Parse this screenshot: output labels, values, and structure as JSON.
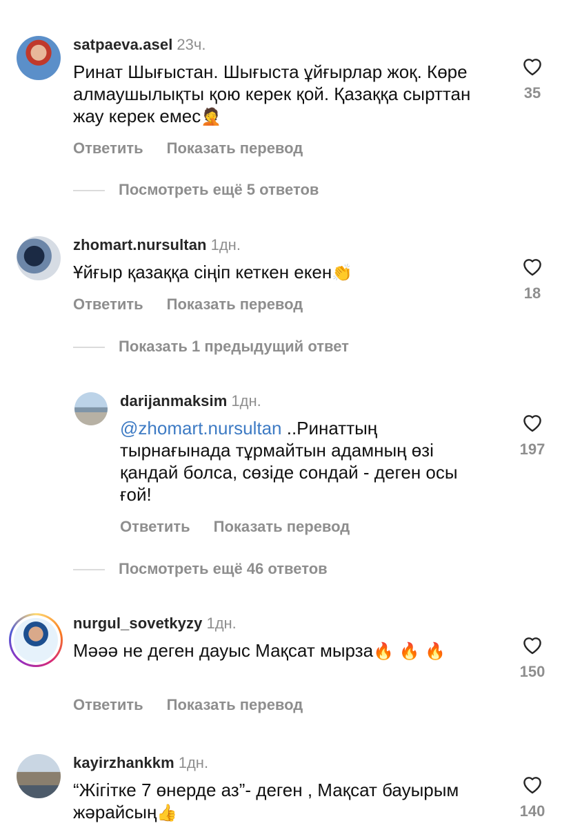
{
  "colors": {
    "accent": "#3e7bc4",
    "muted": "#8e8e8e",
    "story_ring": "#d62976"
  },
  "comments": [
    {
      "username": "satpaeva.asel",
      "time": "23ч.",
      "text": "Ринат Шығыстан. Шығыста ұйғырлар жоқ. Көре алмаушылықты қою керек қой. Қазаққа сырттан жау керек емес",
      "emoji": "🤦",
      "reply_label": "Ответить",
      "translate_label": "Показать перевод",
      "likes": "35",
      "more_replies": "Посмотреть ещё 5 ответов"
    },
    {
      "username": "zhomart.nursultan",
      "time": "1дн.",
      "text": "Ұйғыр қазаққа сіңіп кеткен екен",
      "emoji": "👏",
      "reply_label": "Ответить",
      "translate_label": "Показать перевод",
      "likes": "18",
      "previous_replies": "Показать 1 предыдущий ответ"
    },
    {
      "username": "darijanmaksim",
      "time": "1дн.",
      "mention": "@zhomart.nursultan",
      "text": " ..Ринаттың тырнағынада тұрмайтын адамның өзі қандай болса, сөзіде сондай - деген осы ғой!",
      "reply_label": "Ответить",
      "translate_label": "Показать перевод",
      "likes": "197",
      "more_replies": "Посмотреть ещё 46 ответов"
    },
    {
      "username": "nurgul_sovetkyzy",
      "time": "1дн.",
      "text": "Мәәә не деген дауыс Мақсат мырза",
      "emoji": "🔥 🔥 🔥",
      "reply_label": "Ответить",
      "translate_label": "Показать перевод",
      "likes": "150"
    },
    {
      "username": "kayirzhankkm",
      "time": "1дн.",
      "text": "“Жігітке 7 өнерде аз”- деген , Мақсат бауырым жәрайсың",
      "emoji": "👍",
      "likes": "140"
    }
  ],
  "icons": {
    "like": "heart-outline-icon"
  }
}
